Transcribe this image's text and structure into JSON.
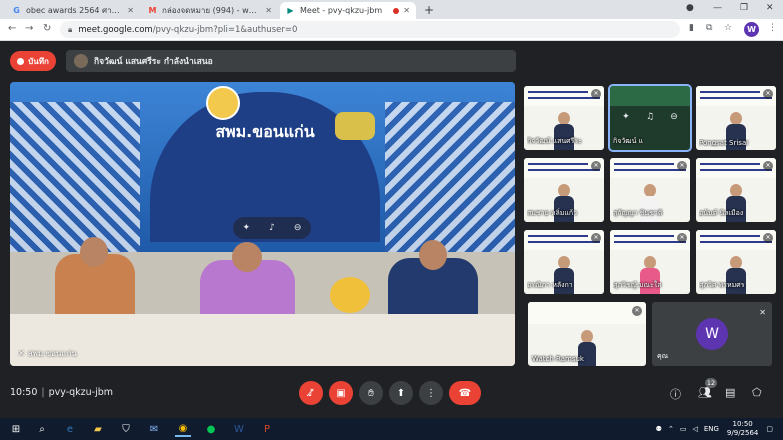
{
  "browser": {
    "tabs": [
      {
        "title": "obec awards 2564 ศาสตร์นอกเห็",
        "favicon": "G",
        "favicon_color": "#4285f4",
        "active": false,
        "recording": false
      },
      {
        "title": "กล่องจดหมาย (994) - wounjaichon",
        "favicon": "M",
        "favicon_color": "#ea4335",
        "active": false,
        "recording": false
      },
      {
        "title": "Meet - pvy-qkzu-jbm",
        "favicon": "▶",
        "favicon_color": "#00897b",
        "active": true,
        "recording": true
      }
    ],
    "new_tab": "+",
    "url_host": "meet.google.com",
    "url_path": "/pvy-qkzu-jbm?pli=1&authuser=0",
    "profile_initial": "W"
  },
  "meet": {
    "record_label": "บันทึก",
    "presenter_banner": "กิจวัฒน์ แสนศรีระ กำลังนำเสนอ",
    "stage_name": "สพม.ขอนแก่น",
    "stage_sign": "สพม.ขอนแก่น",
    "tiles": [
      {
        "name": "กิจวัฒน์ แสนศรีระ",
        "pinned": false
      },
      {
        "name": "กิจวัฒน์ แ",
        "pinned": true
      },
      {
        "name": "Pongsat Srisai",
        "pinned": false
      },
      {
        "name": "สมชาย หลิ่มแก้ว",
        "pinned": false
      },
      {
        "name": "สุกัญญา ชินชาติ",
        "pinned": false
      },
      {
        "name": "อนันต์ นิลเมือง",
        "pinned": false
      },
      {
        "name": "อรณิภา หลังกา",
        "pinned": false
      },
      {
        "name": "ศุภวิชญ์ มณะใส",
        "pinned": false
      },
      {
        "name": "ศุภวิศ พรหมศร",
        "pinned": false
      }
    ],
    "self_large": {
      "name": "Watch Ramsuk"
    },
    "you": {
      "name": "คุณ",
      "initial": "W"
    },
    "time": "10:50",
    "separator": "|",
    "meeting_code": "pvy-qkzu-jbm",
    "people_count": "12"
  },
  "taskbar": {
    "language": "ENG",
    "time": "10:50",
    "date": "9/9/2564"
  },
  "colors": {
    "accent_red": "#ea4335",
    "meet_bg": "#202124",
    "control_grey": "#3c4043",
    "taskbar": "#101c2e"
  }
}
